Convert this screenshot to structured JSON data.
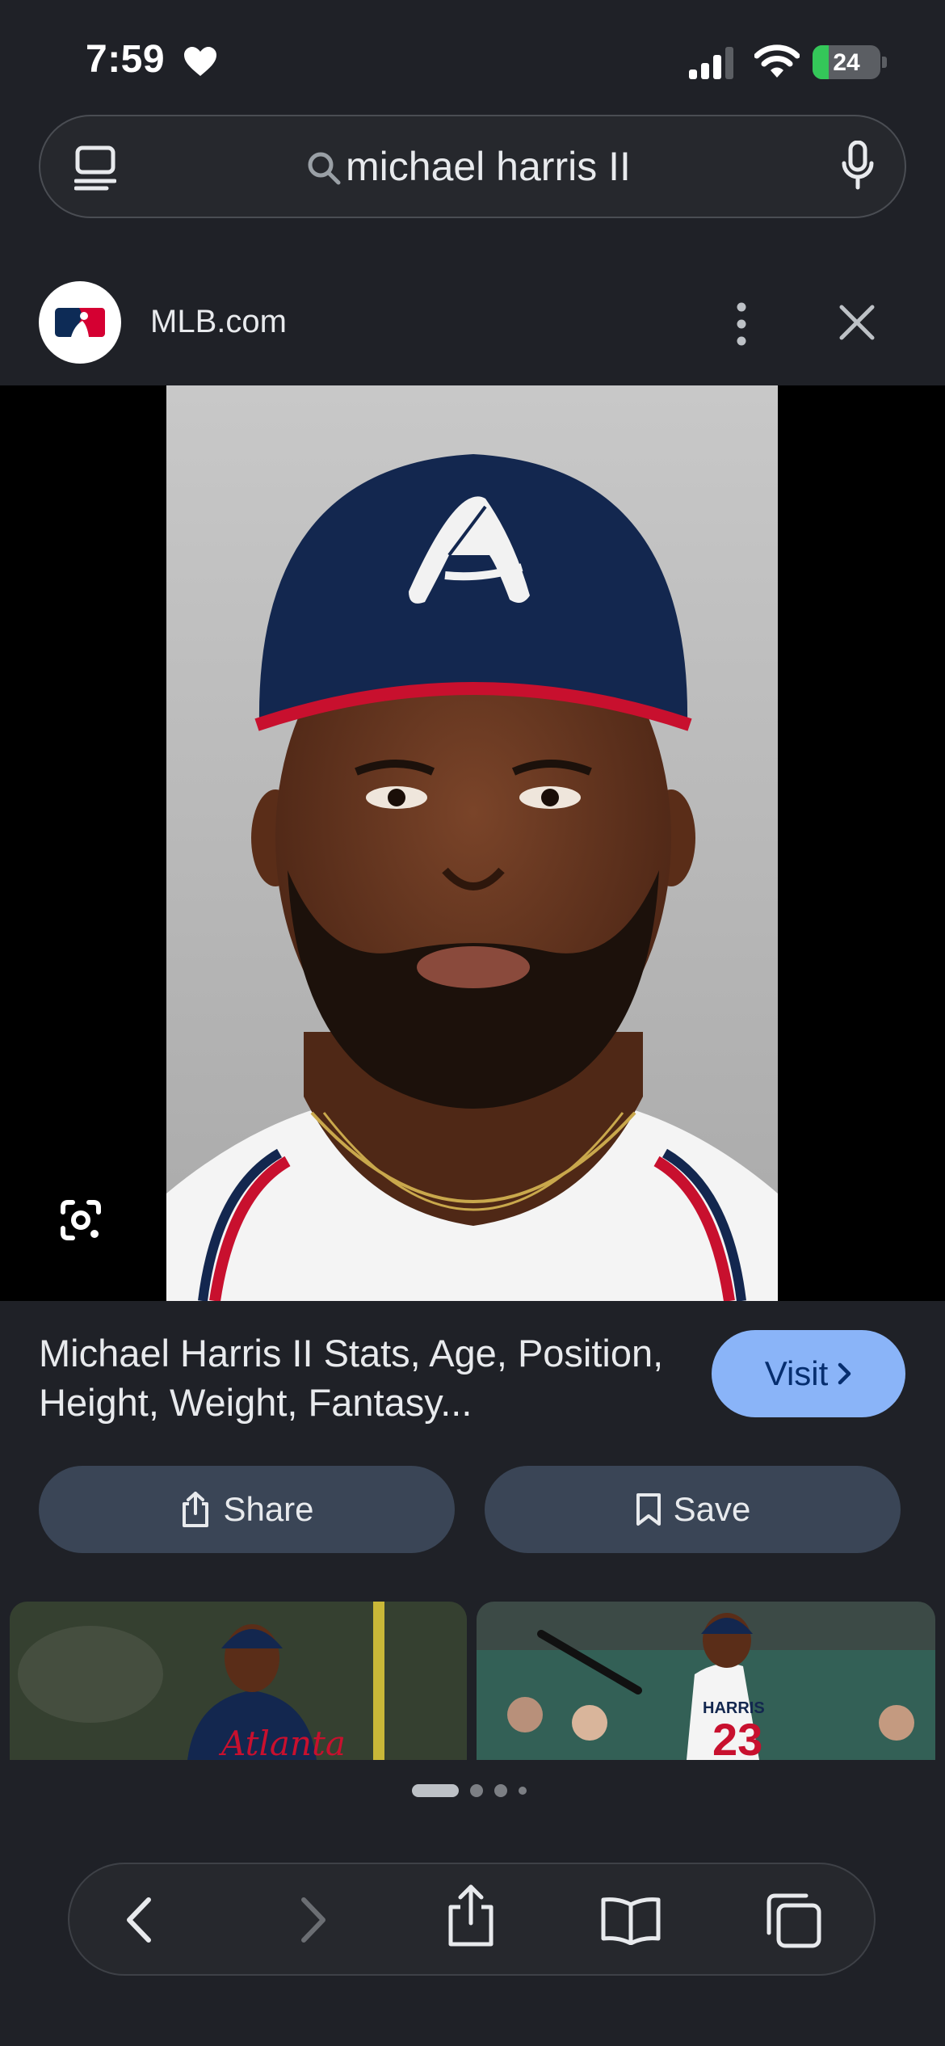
{
  "status_bar": {
    "time": "7:59",
    "battery": "24",
    "battery_level": 0.24
  },
  "search": {
    "query": "michael harris II"
  },
  "source": {
    "name": "MLB.com"
  },
  "result": {
    "title": "Michael Harris II Stats, Age, Position, Height, Weight, Fantasy...",
    "visit_label": "Visit",
    "share_label": "Share",
    "save_label": "Save"
  },
  "thumbnails": [
    {
      "jersey_text": "Atlanta"
    },
    {
      "jersey_text": "HARRIS",
      "number": "23"
    }
  ],
  "page_indicator": {
    "current": 1,
    "total": 4
  },
  "colors": {
    "background": "#1f2127",
    "visit_button": "#8ab4f8",
    "pill_button": "#3a4556",
    "battery_green": "#34c759"
  }
}
